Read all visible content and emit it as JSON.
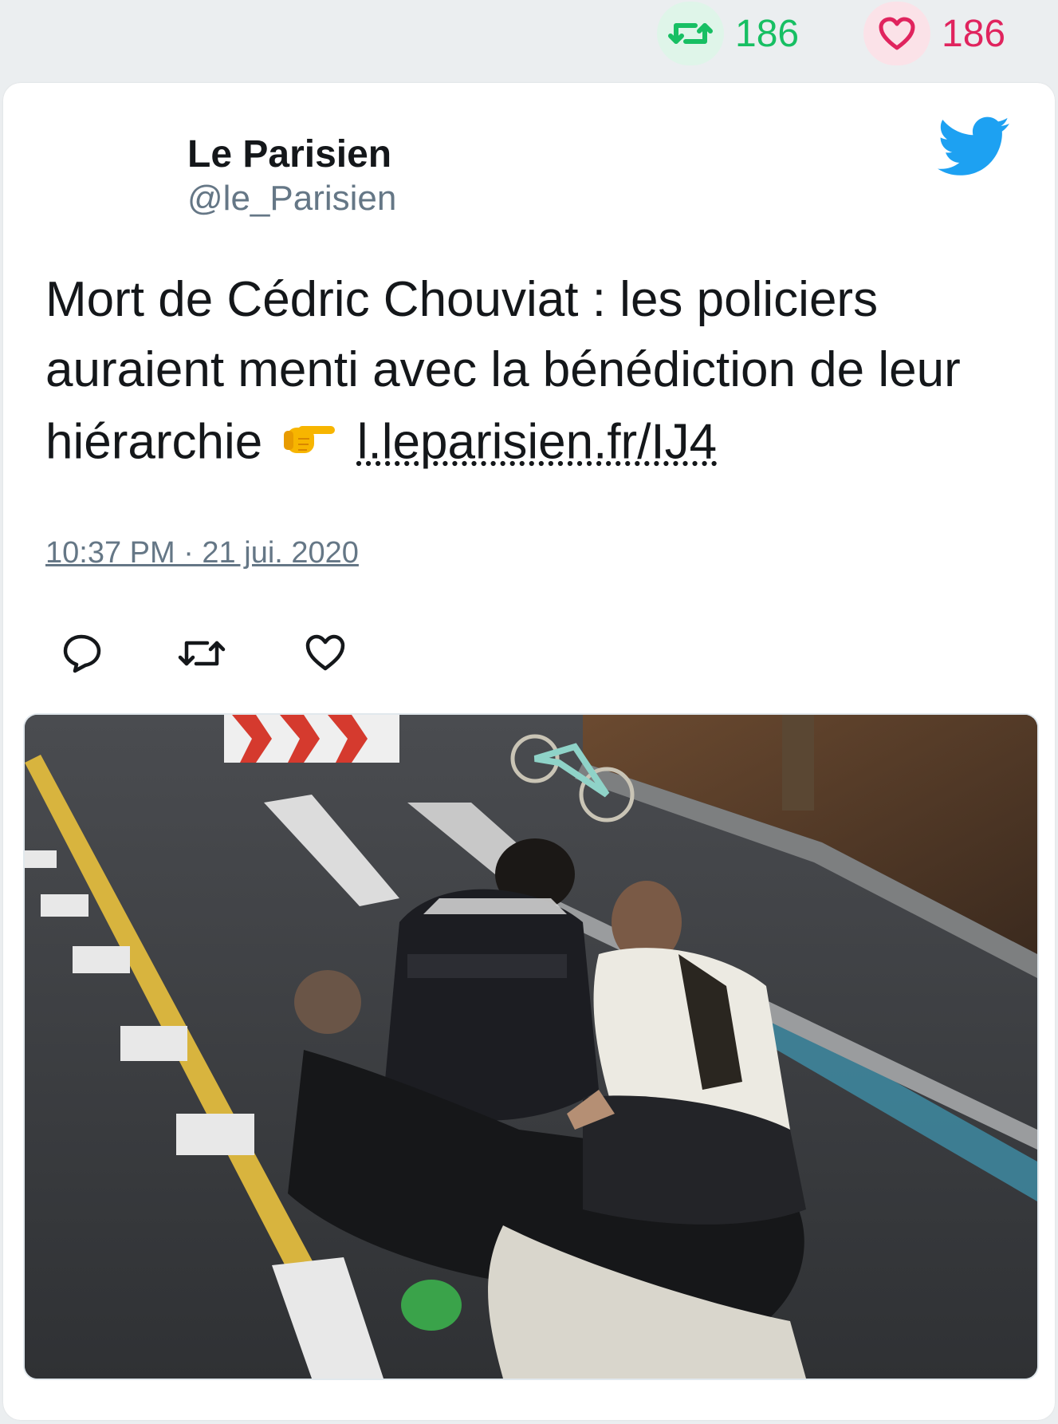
{
  "stats": {
    "retweets": "186",
    "likes": "186"
  },
  "tweet": {
    "author_name": "Le Parisien",
    "author_handle": "@le_Parisien",
    "text_main": "Mort de Cédric Chouviat : les policiers auraient menti avec la bénédiction de leur hiérarchie",
    "link": "l.leparisien.fr/IJ4",
    "timestamp": "10:37 PM · 21 jui. 2020"
  },
  "icons": {
    "retweet": "retweet-icon",
    "like": "heart-icon",
    "reply": "reply-icon",
    "brand": "twitter-bird-icon",
    "emoji": "pointing-right-emoji"
  },
  "colors": {
    "retweet": "#17bf63",
    "like": "#e0245e",
    "twitter_blue": "#1da1f2",
    "secondary_text": "#657786"
  }
}
